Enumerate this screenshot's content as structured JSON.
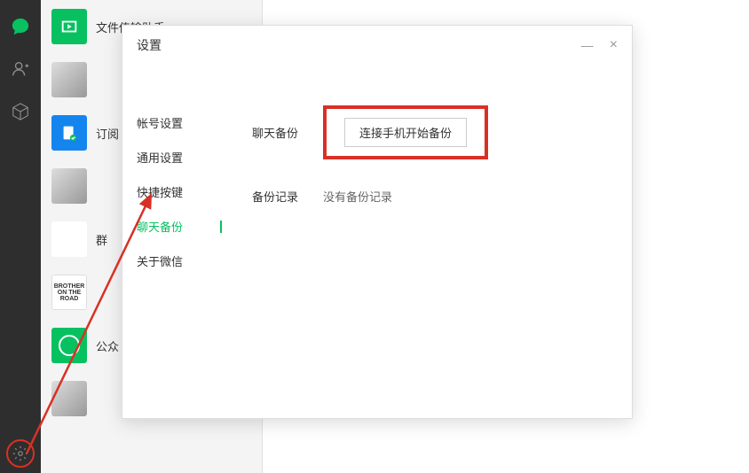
{
  "chat_list": {
    "items": [
      {
        "name": "文件传输助手"
      },
      {
        "name": ""
      },
      {
        "name": "订阅"
      },
      {
        "name": ""
      },
      {
        "name": "群"
      },
      {
        "name": ""
      },
      {
        "name": "公众"
      },
      {
        "name": ""
      }
    ]
  },
  "avatar_ontheroad": {
    "line1": "BROTHER",
    "line2": "ON THE ROAD"
  },
  "settings": {
    "title": "设置",
    "nav": {
      "account": "帐号设置",
      "general": "通用设置",
      "shortcut": "快捷按键",
      "backup": "聊天备份",
      "about": "关于微信"
    },
    "content": {
      "backup_label": "聊天备份",
      "backup_button": "连接手机开始备份",
      "record_label": "备份记录",
      "record_value": "没有备份记录"
    },
    "controls": {
      "minimize": "—",
      "close": "×"
    }
  }
}
